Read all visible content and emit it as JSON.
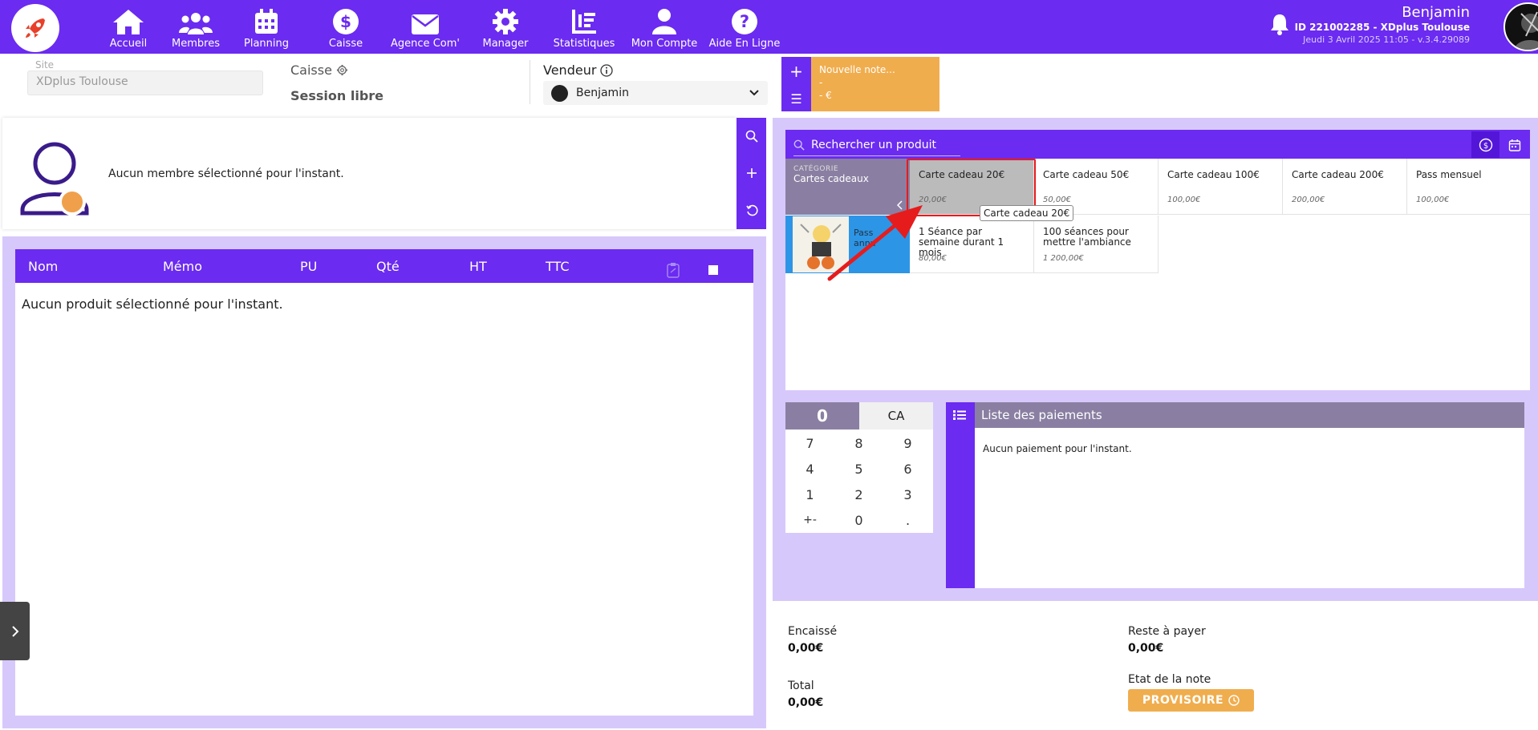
{
  "nav": {
    "items": [
      {
        "label": "Accueil"
      },
      {
        "label": "Membres"
      },
      {
        "label": "Planning"
      },
      {
        "label": "Caisse"
      },
      {
        "label": "Agence Com'"
      },
      {
        "label": "Manager"
      },
      {
        "label": "Statistiques"
      },
      {
        "label": "Mon Compte"
      },
      {
        "label": "Aide En Ligne"
      }
    ]
  },
  "user": {
    "name": "Benjamin",
    "id_line": "ID 221002285 - XDplus Toulouse",
    "date_line": "Jeudi 3 Avril 2025 11:05 - v.3.4.29089"
  },
  "header": {
    "site_label": "Site",
    "site_value": "XDplus Toulouse",
    "caisse_title": "Caisse",
    "session": "Session libre",
    "vendeur_title": "Vendeur",
    "vendeur_value": "Benjamin"
  },
  "note": {
    "title": "Nouvelle note...",
    "line2": "-",
    "amount": "- €"
  },
  "member": {
    "empty_text": "Aucun membre sélectionné pour l'instant."
  },
  "table": {
    "columns": [
      "Nom",
      "Mémo",
      "PU",
      "Qté",
      "HT",
      "TTC"
    ],
    "empty_text": "Aucun produit sélectionné pour l'instant."
  },
  "products": {
    "search_placeholder": "Rechercher un produit",
    "category_key": "CATÉGORIE",
    "category_value": "Cartes cadeaux",
    "row1": [
      {
        "name": "Carte cadeau 20€",
        "price": "20,00€"
      },
      {
        "name": "Carte cadeau 50€",
        "price": "50,00€"
      },
      {
        "name": "Carte cadeau 100€",
        "price": "100,00€"
      },
      {
        "name": "Carte cadeau 200€",
        "price": "200,00€"
      },
      {
        "name": "Pass mensuel",
        "price": "100,00€"
      }
    ],
    "pass_label_1": "Pass",
    "pass_label_2": "annu",
    "row2": [
      {
        "name": "1 Séance par semaine durant 1 mois",
        "price": "80,00€"
      },
      {
        "name": "100 séances pour mettre l'ambiance",
        "price": "1 200,00€"
      }
    ],
    "tooltip": "Carte cadeau 20€"
  },
  "keypad": {
    "display": "0",
    "mode": "CA",
    "keys": [
      "7",
      "8",
      "9",
      "4",
      "5",
      "6",
      "1",
      "2",
      "3",
      "+-",
      "0",
      "."
    ]
  },
  "payments": {
    "title": "Liste des paiements",
    "empty_text": "Aucun paiement pour l'instant."
  },
  "totals": {
    "encaisse_label": "Encaissé",
    "encaisse_value": "0,00€",
    "reste_label": "Reste à payer",
    "reste_value": "0,00€",
    "total_label": "Total",
    "total_value": "0,00€",
    "etat_label": "Etat de la note",
    "etat_value": "PROVISOIRE"
  },
  "colors": {
    "primary": "#6b2bf0",
    "lavender": "#d7c8fb",
    "orange": "#f0ad4e",
    "grey_header": "#8a7fa2",
    "highlight_red": "#e61c1c"
  }
}
